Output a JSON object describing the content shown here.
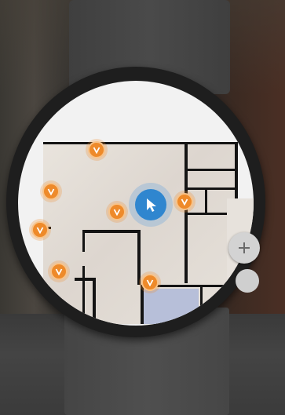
{
  "app": {
    "screen": "indoor-map",
    "colors": {
      "marker_fill": "#ee8a2a",
      "marker_ring": "#f7c38a",
      "user_fill": "#2f86cf",
      "zoom_button": "#d3d3d3",
      "watch_bezel": "#1e1e1e"
    }
  },
  "map": {
    "markers": [
      {
        "icon": "check-v-icon"
      },
      {
        "icon": "check-v-icon"
      },
      {
        "icon": "check-v-icon"
      },
      {
        "icon": "check-v-icon"
      },
      {
        "icon": "check-v-icon"
      },
      {
        "icon": "check-v-icon"
      },
      {
        "icon": "check-v-icon"
      }
    ],
    "user_location": {
      "icon": "navigation-arrow-icon"
    }
  },
  "controls": {
    "zoom_in": {
      "icon": "plus-icon"
    },
    "zoom_out": {
      "icon": "minus-icon"
    }
  }
}
